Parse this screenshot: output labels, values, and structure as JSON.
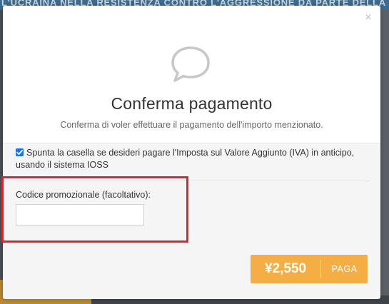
{
  "background": {
    "banner_text": "L'UCRAINA NELLA RESISTENZA CONTRO L'AGGRESSIONE DA PARTE DELLA FEDERAZIONE"
  },
  "modal": {
    "close_label": "×",
    "icon": "speech-bubble-icon",
    "title": "Conferma pagamento",
    "subtitle": "Conferma di voler effettuare il pagamento dell'importo menzionato.",
    "vat_checkbox": {
      "checked": true,
      "label": "Spunta la casella se desideri pagare l'Imposta sul Valore Aggiunto (IVA) in anticipo, usando il sistema IOSS"
    },
    "promo": {
      "label": "Codice promozionale (facoltativo):",
      "value": "",
      "placeholder": ""
    },
    "pay_button": {
      "amount": "¥2,550",
      "label": "PAGA"
    }
  },
  "colors": {
    "accent": "#f4ae43",
    "highlight_frame": "#d9252f",
    "checkbox": "#1a73e8"
  }
}
